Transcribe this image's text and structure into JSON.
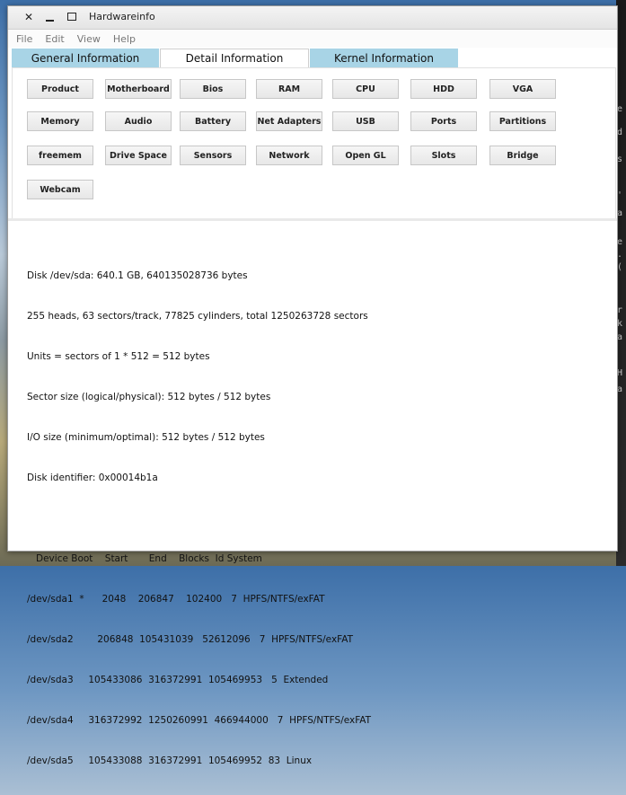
{
  "window": {
    "title": "Hardwareinfo"
  },
  "menu": [
    "File",
    "Edit",
    "View",
    "Help"
  ],
  "tabs": [
    "General Information",
    "Detail Information",
    "Kernel Information"
  ],
  "buttons": [
    "Product",
    "Motherboard",
    "Bios",
    "RAM",
    "CPU",
    "HDD",
    "VGA",
    "Memory",
    "Audio",
    "Battery",
    "Net Adapters",
    "USB",
    "Ports",
    "Partitions",
    "freemem",
    "Drive Space",
    "Sensors",
    "Network",
    "Open GL",
    "Slots",
    "Bridge",
    "Webcam"
  ],
  "output": {
    "lines": [
      "Disk /dev/sda: 640.1 GB, 640135028736 bytes",
      "255 heads, 63 sectors/track, 77825 cylinders, total 1250263728 sectors",
      "Units = sectors of 1 * 512 = 512 bytes",
      "Sector size (logical/physical): 512 bytes / 512 bytes",
      "I/O size (minimum/optimal): 512 bytes / 512 bytes",
      "Disk identifier: 0x00014b1a",
      "",
      "   Device Boot    Start       End    Blocks  Id System",
      "/dev/sda1  *      2048    206847    102400   7  HPFS/NTFS/exFAT",
      "/dev/sda2        206848  105431039   52612096   7  HPFS/NTFS/exFAT",
      "/dev/sda3     105433086  316372991  105469953   5  Extended",
      "/dev/sda4     316372992  1250260991  466944000   7  HPFS/NTFS/exFAT",
      "/dev/sda5     105433088  316372991  105469952  83  Linux"
    ]
  },
  "background_terminal_glyphs": [
    "e",
    "d",
    "s",
    "'",
    "a",
    "e",
    ".",
    "(",
    "r",
    "k",
    "a",
    "H",
    "a"
  ]
}
